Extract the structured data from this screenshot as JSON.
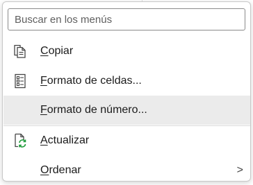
{
  "search": {
    "placeholder": "Buscar en los menús"
  },
  "menu": {
    "items": [
      {
        "label_first": "C",
        "label_rest": "opiar",
        "icon": "copy-icon"
      },
      {
        "label_first": "F",
        "label_rest": "ormato de celdas...",
        "icon": "format-cells-icon"
      },
      {
        "label_first": "F",
        "label_rest": "ormato de número...",
        "icon": ""
      },
      {
        "label_first": "A",
        "label_rest": "ctualizar",
        "icon": "refresh-icon"
      },
      {
        "label_first": "O",
        "label_rest": "rdenar",
        "icon": "",
        "submenu_glyph": ">"
      }
    ]
  },
  "colors": {
    "hover": "#ebebeb",
    "refresh_green": "#1e9b3a",
    "icon_stroke": "#444444"
  }
}
